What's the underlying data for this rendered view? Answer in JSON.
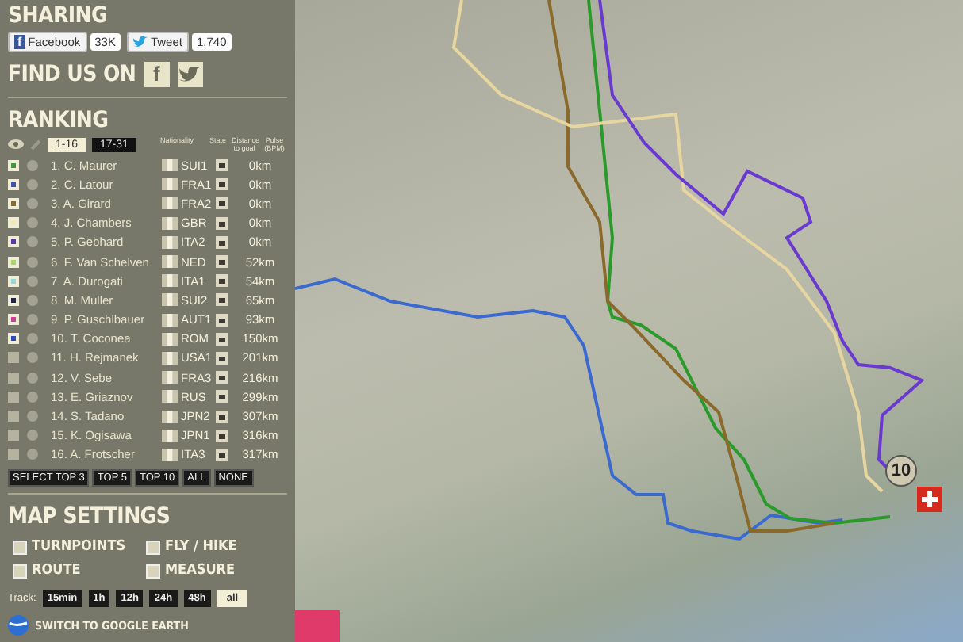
{
  "sharing": {
    "title": "SHARING",
    "facebook": {
      "icon_glyph": "f",
      "label": "Facebook",
      "count": "33K"
    },
    "twitter": {
      "label": "Tweet",
      "count": "1,740"
    }
  },
  "find_us": {
    "title": "FIND US ON",
    "facebook_glyph": "f"
  },
  "ranking": {
    "title": "RANKING",
    "tabs": [
      {
        "label": "1-16",
        "selected": true
      },
      {
        "label": "17-31",
        "selected": false
      }
    ],
    "columns": [
      "Nationality",
      "State",
      "Distance to goal",
      "Pulse (BPM)"
    ],
    "rows": [
      {
        "name": "1. C. Maurer",
        "checked": true,
        "color": "#3c9a3c",
        "nationality": "SUI1",
        "distance": "0km"
      },
      {
        "name": "2. C. Latour",
        "checked": true,
        "color": "#3a55b0",
        "nationality": "FRA1",
        "distance": "0km"
      },
      {
        "name": "3. A. Girard",
        "checked": true,
        "color": "#8a6a2a",
        "nationality": "FRA2",
        "distance": "0km"
      },
      {
        "name": "4. J. Chambers",
        "checked": true,
        "color": "#f1e9b0",
        "nationality": "GBR",
        "distance": "0km"
      },
      {
        "name": "5. P. Gebhard",
        "checked": true,
        "color": "#5a35b5",
        "nationality": "ITA2",
        "distance": "0km"
      },
      {
        "name": "6. F. Van Schelven",
        "checked": true,
        "color": "#a8d860",
        "nationality": "NED",
        "distance": "52km"
      },
      {
        "name": "7. A. Durogati",
        "checked": true,
        "color": "#8fd8e0",
        "nationality": "ITA1",
        "distance": "54km"
      },
      {
        "name": "8. M. Muller",
        "checked": true,
        "color": "#1c2450",
        "nationality": "SUI2",
        "distance": "65km"
      },
      {
        "name": "9. P. Guschlbauer",
        "checked": true,
        "color": "#d03ca0",
        "nationality": "AUT1",
        "distance": "93km"
      },
      {
        "name": "10. T. Coconea",
        "checked": true,
        "color": "#2a4ac0",
        "nationality": "ROM",
        "distance": "150km"
      },
      {
        "name": "11. H. Rejmanek",
        "checked": false,
        "nationality": "USA1",
        "distance": "201km"
      },
      {
        "name": "12. V. Sebe",
        "checked": false,
        "nationality": "FRA3",
        "distance": "216km"
      },
      {
        "name": "13. E. Griaznov",
        "checked": false,
        "nationality": "RUS",
        "distance": "299km"
      },
      {
        "name": "14. S. Tadano",
        "checked": false,
        "nationality": "JPN2",
        "distance": "307km"
      },
      {
        "name": "15. K. Ogisawa",
        "checked": false,
        "nationality": "JPN1",
        "distance": "316km"
      },
      {
        "name": "16. A. Frotscher",
        "checked": false,
        "nationality": "ITA3",
        "distance": "317km"
      }
    ],
    "select_buttons": [
      "SELECT TOP 3",
      "TOP 5",
      "TOP 10",
      "ALL",
      "NONE"
    ]
  },
  "map_settings": {
    "title": "MAP SETTINGS",
    "options": [
      {
        "label": "TURNPOINTS",
        "checked": false
      },
      {
        "label": "FLY / HIKE",
        "checked": false
      },
      {
        "label": "ROUTE",
        "checked": false
      },
      {
        "label": "MEASURE",
        "checked": false
      }
    ],
    "track_label": "Track:",
    "track": [
      {
        "label": "15min",
        "selected": false
      },
      {
        "label": "1h",
        "selected": false
      },
      {
        "label": "12h",
        "selected": false
      },
      {
        "label": "24h",
        "selected": false
      },
      {
        "label": "48h",
        "selected": false
      },
      {
        "label": "all",
        "selected": true
      }
    ],
    "google_earth": "SWITCH TO GOOGLE EARTH"
  },
  "map": {
    "marker": "10"
  }
}
